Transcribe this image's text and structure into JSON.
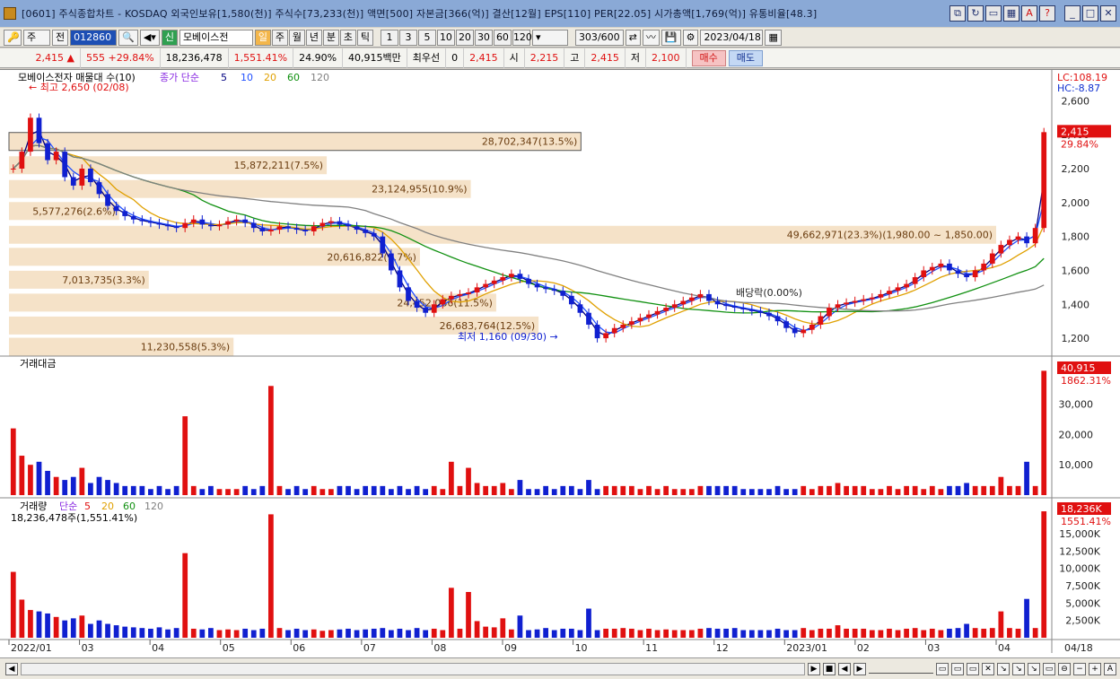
{
  "window": {
    "title": "[0601] 주식종합차트 - KOSDAQ 외국인보유[1,580(천)] 주식수[73,233(천)] 액면[500] 자본금[366(억)] 결산[12월] EPS[110] PER[22.05] 시가총액[1,769(억)] 유통비율[48.3]",
    "buttons": [
      "□",
      "?",
      "▭",
      "☒",
      "A",
      "?",
      "_",
      "□",
      "X"
    ]
  },
  "toolbar": {
    "type_select": "주",
    "all_label": "전",
    "stock_code": "012860",
    "stock_name": "모베이스전",
    "periods": [
      "일",
      "주",
      "월",
      "년",
      "분",
      "초",
      "틱"
    ],
    "active_period": "일",
    "intervals": [
      "1",
      "3",
      "5",
      "10",
      "20",
      "30",
      "60",
      "120"
    ],
    "count": "303",
    "count_max": "/600",
    "date": "2023/04/18"
  },
  "quote": {
    "price": "2,415",
    "change": "555 +29.84%",
    "volume": "18,236,478",
    "volume_ratio": "1,551.41%",
    "turnover": "24.90%",
    "amount": "40,915백만",
    "priority": "최우선",
    "priority_val": "0",
    "priority_price": "2,415",
    "open_label": "시",
    "open": "2,215",
    "high_label": "고",
    "high": "2,415",
    "low_label": "저",
    "low": "2,100",
    "buy": "매수",
    "sell": "매도"
  },
  "price_panel": {
    "legend_name": "모베이스전자 매물대 수(10)",
    "ma_legend": "종가 단순",
    "ma_periods": [
      "5",
      "10",
      "20",
      "60",
      "120"
    ],
    "ma_colors": [
      "#000080",
      "#2050ff",
      "#e0a000",
      "#109010",
      "#808080"
    ],
    "high_marker": "최고 2,650 (02/08)",
    "low_marker": "최저 1,160 (09/30)",
    "dividend_marker": "배당락(0.00%)",
    "lc": "LC:108.19",
    "hc": "HC:-8.87",
    "current_price": "2,415",
    "current_pct": "29.84%",
    "yticks": [
      "2,600",
      "2,400",
      "2,200",
      "2,000",
      "1,800",
      "1,600",
      "1,400",
      "1,200"
    ],
    "volume_profile": [
      {
        "label": "28,702,347(13.5%)",
        "price": 2360,
        "pct": 13.5
      },
      {
        "label": "15,872,211(7.5%)",
        "price": 2220,
        "pct": 7.5
      },
      {
        "label": "23,124,955(10.9%)",
        "price": 2080,
        "pct": 10.9
      },
      {
        "label": "5,577,276(2.6%)",
        "price": 1950,
        "pct": 2.6
      },
      {
        "label": "49,662,971(23.3%)(1,980.00 ~ 1,850.00)",
        "price": 1810,
        "pct": 23.3
      },
      {
        "label": "20,616,822(9.7%)",
        "price": 1680,
        "pct": 9.7
      },
      {
        "label": "7,013,735(3.3%)",
        "price": 1545,
        "pct": 3.3
      },
      {
        "label": "24,452,086(11.5%)",
        "price": 1410,
        "pct": 11.5
      },
      {
        "label": "26,683,764(12.5%)",
        "price": 1275,
        "pct": 12.5
      },
      {
        "label": "11,230,558(5.3%)",
        "price": 1150,
        "pct": 5.3
      }
    ]
  },
  "amount_panel": {
    "legend": "거래대금",
    "current": "40,915",
    "current_pct": "1862.31%",
    "yticks": [
      "30,000",
      "20,000",
      "10,000"
    ]
  },
  "volume_panel": {
    "legend_name": "거래량",
    "ma_legend": "단순",
    "ma_periods": [
      "5",
      "20",
      "60",
      "120"
    ],
    "summary": "18,236,478주(1,551.41%)",
    "current": "18,236K",
    "current_pct": "1551.41%",
    "yticks": [
      "15,000K",
      "12,500K",
      "10,000K",
      "7,500K",
      "5,000K",
      "2,500K"
    ]
  },
  "xaxis": {
    "labels": [
      "2022/01",
      "03",
      "04",
      "05",
      "06",
      "07",
      "08",
      "09",
      "10",
      "11",
      "12",
      "2023/01",
      "02",
      "03",
      "04"
    ],
    "end_date": "04/18"
  },
  "chart_data": {
    "type": "candlestick",
    "price_range": [
      1100,
      2750
    ],
    "closes": [
      2200,
      2300,
      2500,
      2350,
      2250,
      2300,
      2150,
      2100,
      2200,
      2120,
      2050,
      1980,
      1950,
      1920,
      1900,
      1890,
      1880,
      1870,
      1860,
      1850,
      1880,
      1900,
      1870,
      1860,
      1870,
      1890,
      1900,
      1880,
      1850,
      1830,
      1840,
      1860,
      1850,
      1840,
      1830,
      1860,
      1880,
      1890,
      1870,
      1860,
      1840,
      1820,
      1800,
      1700,
      1600,
      1500,
      1420,
      1380,
      1350,
      1400,
      1430,
      1450,
      1460,
      1470,
      1500,
      1520,
      1540,
      1560,
      1580,
      1550,
      1520,
      1500,
      1490,
      1480,
      1450,
      1400,
      1350,
      1280,
      1200,
      1230,
      1260,
      1280,
      1300,
      1320,
      1340,
      1360,
      1380,
      1400,
      1420,
      1440,
      1460,
      1420,
      1400,
      1390,
      1380,
      1370,
      1360,
      1350,
      1330,
      1300,
      1260,
      1230,
      1250,
      1280,
      1330,
      1380,
      1400,
      1410,
      1420,
      1430,
      1440,
      1460,
      1480,
      1500,
      1520,
      1560,
      1600,
      1620,
      1640,
      1600,
      1580,
      1560,
      1600,
      1640,
      1700,
      1750,
      1780,
      1800,
      1760,
      1850,
      2415
    ],
    "amounts_thousands": [
      22,
      13,
      10,
      11,
      8,
      6,
      5,
      6,
      9,
      4,
      6,
      5,
      4,
      3,
      3,
      3,
      2,
      3,
      2,
      3,
      26,
      3,
      2,
      3,
      2,
      2,
      2,
      3,
      2,
      3,
      36,
      3,
      2,
      3,
      2,
      3,
      2,
      2,
      3,
      3,
      2,
      3,
      3,
      3,
      2,
      3,
      2,
      3,
      2,
      3,
      2,
      11,
      3,
      9,
      4,
      3,
      3,
      4,
      2,
      5,
      2,
      2,
      3,
      2,
      3,
      3,
      2,
      5,
      2,
      3,
      3,
      3,
      3,
      2,
      3,
      2,
      3,
      2,
      2,
      2,
      3,
      3,
      3,
      3,
      3,
      2,
      2,
      2,
      2,
      3,
      2,
      2,
      3,
      2,
      3,
      3,
      4,
      3,
      3,
      3,
      2,
      2,
      3,
      2,
      3,
      3,
      2,
      3,
      2,
      3,
      3,
      4,
      3,
      3,
      3,
      6,
      3,
      3,
      11,
      3,
      41
    ],
    "volumes_thousands": [
      9500,
      5500,
      4000,
      3800,
      3500,
      3000,
      2500,
      2800,
      3200,
      2000,
      2500,
      2000,
      1800,
      1600,
      1500,
      1400,
      1300,
      1500,
      1200,
      1400,
      12200,
      1300,
      1200,
      1400,
      1100,
      1200,
      1100,
      1300,
      1100,
      1300,
      17800,
      1400,
      1100,
      1300,
      1100,
      1200,
      1000,
      1100,
      1200,
      1300,
      1100,
      1200,
      1300,
      1400,
      1100,
      1300,
      1100,
      1400,
      1100,
      1300,
      1100,
      7200,
      1300,
      6600,
      2400,
      1600,
      1500,
      2800,
      1200,
      3200,
      1100,
      1200,
      1400,
      1100,
      1300,
      1300,
      1100,
      4200,
      1100,
      1300,
      1300,
      1400,
      1300,
      1100,
      1300,
      1100,
      1200,
      1100,
      1100,
      1100,
      1300,
      1400,
      1300,
      1300,
      1400,
      1100,
      1100,
      1100,
      1100,
      1300,
      1100,
      1100,
      1400,
      1100,
      1300,
      1300,
      1800,
      1300,
      1300,
      1300,
      1100,
      1100,
      1300,
      1100,
      1300,
      1400,
      1100,
      1300,
      1100,
      1300,
      1400,
      2000,
      1400,
      1300,
      1400,
      3800,
      1400,
      1300,
      5600,
      1400,
      18236
    ]
  }
}
